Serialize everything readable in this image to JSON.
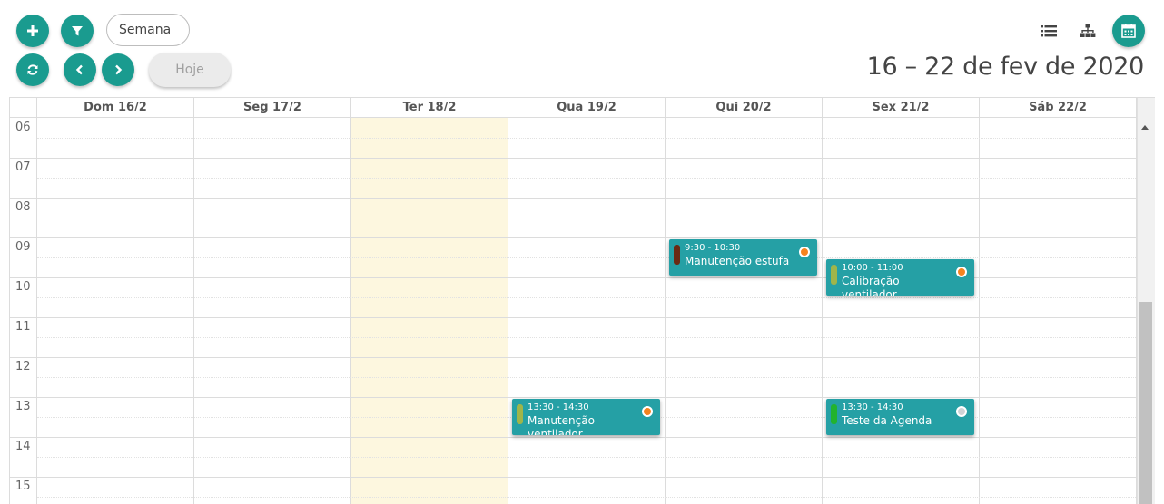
{
  "toolbar": {
    "view_select": "Semana",
    "today_label": "Hoje",
    "range_title": "16 – 22 de fev de 2020"
  },
  "icons": {
    "add": "plus-icon",
    "filter": "filter-icon",
    "refresh": "refresh-icon",
    "prev": "chevron-left-icon",
    "next": "chevron-right-icon",
    "list_view": "list-icon",
    "tree_view": "sitemap-icon",
    "calendar_view": "calendar-icon"
  },
  "colors": {
    "accent": "#1a9b8f",
    "event_bg": "#25a0a5",
    "today_bg": "#fdf7df",
    "status_orange": "#f5831f",
    "status_gray": "#cfd3d6"
  },
  "days": [
    {
      "label": "Dom 16/2",
      "today": false
    },
    {
      "label": "Seg 17/2",
      "today": false
    },
    {
      "label": "Ter 18/2",
      "today": true
    },
    {
      "label": "Qua 19/2",
      "today": false
    },
    {
      "label": "Qui 20/2",
      "today": false
    },
    {
      "label": "Sex 21/2",
      "today": false
    },
    {
      "label": "Sáb 22/2",
      "today": false
    }
  ],
  "hours": [
    "06",
    "07",
    "08",
    "09",
    "10",
    "11",
    "12",
    "13",
    "14",
    "15"
  ],
  "events": [
    {
      "day": 4,
      "start": 9.5,
      "end": 10.5,
      "time": "9:30 - 10:30",
      "title": "Manutenção estufa",
      "tag_color": "#6b2a13",
      "status_color": "#f5831f"
    },
    {
      "day": 5,
      "start": 10.0,
      "end": 11.0,
      "time": "10:00 - 11:00",
      "title": "Calibração ventilador pulmonar",
      "tag_color": "#9fb54a",
      "status_color": "#f5831f"
    },
    {
      "day": 3,
      "start": 13.5,
      "end": 14.5,
      "time": "13:30 - 14:30",
      "title": "Manutenção ventilador pulmonar",
      "tag_color": "#9fb54a",
      "status_color": "#f5831f"
    },
    {
      "day": 5,
      "start": 13.5,
      "end": 14.5,
      "time": "13:30 - 14:30",
      "title": "Teste da Agenda",
      "tag_color": "#22b32e",
      "status_color": "#cfd3d6"
    }
  ]
}
